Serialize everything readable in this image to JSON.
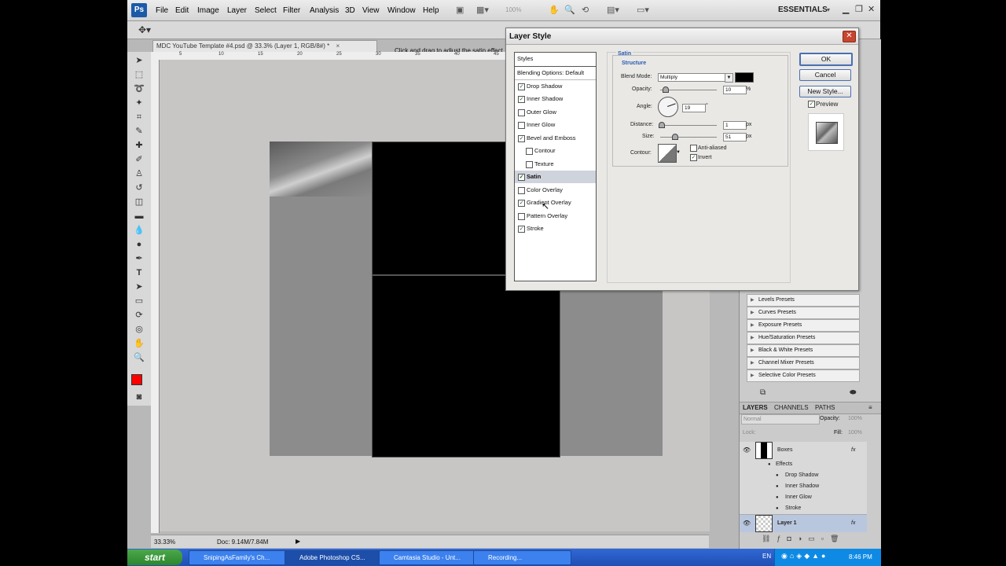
{
  "app": {
    "logo": "Ps",
    "menu": [
      "File",
      "Edit",
      "Image",
      "Layer",
      "Select",
      "Filter",
      "Analysis",
      "3D",
      "View",
      "Window",
      "Help"
    ],
    "zoom_field": "100%",
    "workspace": "ESSENTIALS",
    "hint": "Click and drag to adjust the satin effect."
  },
  "document": {
    "tab_title": "MDC YouTube Template #4.psd @ 33.3% (Layer 1, RGB/8#) *",
    "tab_close": "×",
    "ruler_marks": [
      "5",
      "10",
      "15",
      "20",
      "25",
      "30",
      "35",
      "40",
      "45"
    ],
    "status_zoom": "33.33%",
    "status_doc": "Doc: 9.14M/7.84M"
  },
  "layer_style": {
    "title": "Layer Style",
    "close": "✕",
    "styles_header": "Styles",
    "blending": "Blending Options: Default",
    "effects": [
      {
        "label": "Drop Shadow",
        "checked": true,
        "indent": false
      },
      {
        "label": "Inner Shadow",
        "checked": true,
        "indent": false
      },
      {
        "label": "Outer Glow",
        "checked": false,
        "indent": false
      },
      {
        "label": "Inner Glow",
        "checked": false,
        "indent": false
      },
      {
        "label": "Bevel and Emboss",
        "checked": true,
        "indent": false
      },
      {
        "label": "Contour",
        "checked": false,
        "indent": true
      },
      {
        "label": "Texture",
        "checked": false,
        "indent": true
      },
      {
        "label": "Satin",
        "checked": true,
        "indent": false,
        "selected": true
      },
      {
        "label": "Color Overlay",
        "checked": false,
        "indent": false
      },
      {
        "label": "Gradient Overlay",
        "checked": true,
        "indent": false
      },
      {
        "label": "Pattern Overlay",
        "checked": false,
        "indent": false
      },
      {
        "label": "Stroke",
        "checked": true,
        "indent": false
      }
    ],
    "satin": {
      "section": "Satin",
      "structure": "Structure",
      "blend_mode_label": "Blend Mode:",
      "blend_mode": "Multiply",
      "opacity_label": "Opacity:",
      "opacity": "10",
      "opacity_unit": "%",
      "opacity_fraction": 0.1,
      "angle_label": "Angle:",
      "angle": "19",
      "angle_unit": "°",
      "distance_label": "Distance:",
      "distance": "1",
      "distance_unit": "px",
      "size_label": "Size:",
      "size": "51",
      "size_unit": "px",
      "contour_label": "Contour:",
      "anti_aliased": "Anti-aliased",
      "anti_aliased_checked": false,
      "invert": "Invert",
      "invert_checked": true,
      "color": "#000000"
    },
    "buttons": {
      "ok": "OK",
      "cancel": "Cancel",
      "new_style": "New Style...",
      "preview": "Preview"
    }
  },
  "adjustments": [
    "Levels Presets",
    "Curves Presets",
    "Exposure Presets",
    "Hue/Saturation Presets",
    "Black & White Presets",
    "Channel Mixer Presets",
    "Selective Color Presets"
  ],
  "layers_panel": {
    "tabs": [
      "LAYERS",
      "CHANNELS",
      "PATHS"
    ],
    "blend": "Normal",
    "opacity_label": "Opacity:",
    "opacity": "100%",
    "lock_label": "Lock:",
    "fill_label": "Fill:",
    "fill": "100%",
    "layers": [
      {
        "name": "Boxes",
        "fx": "fx"
      },
      {
        "name": "Effects"
      },
      {
        "name": "Drop Shadow"
      },
      {
        "name": "Inner Shadow"
      },
      {
        "name": "Inner Glow"
      },
      {
        "name": "Stroke"
      },
      {
        "name": "Layer 1",
        "fx": "fx"
      }
    ]
  },
  "taskbar": {
    "start": "start",
    "tasks": [
      "SnipingAsFamily's Ch...",
      "Adobe Photoshop CS...",
      "Camtasia Studio - Unt...",
      "Recording..."
    ],
    "lang": "EN",
    "time": "8:46 PM"
  },
  "colors": {
    "foreground": "#ff0000",
    "background": "#ffffff",
    "accent": "#1c5aa8"
  }
}
